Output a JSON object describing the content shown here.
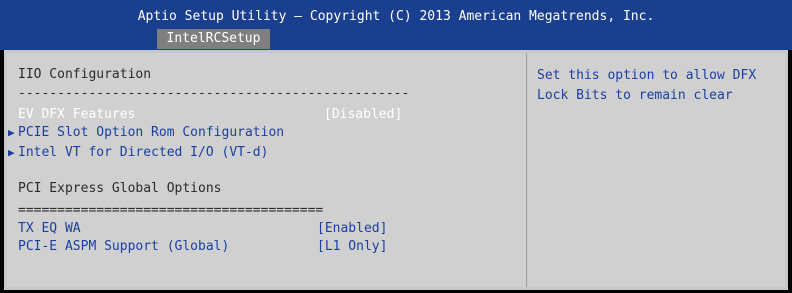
{
  "header": {
    "title": "Aptio Setup Utility – Copyright (C) 2013 American Megatrends, Inc.",
    "active_tab": "IntelRCSetup"
  },
  "main": {
    "section_title": "IIO Configuration",
    "separator_dash": "--------------------------------------------------",
    "items": [
      {
        "label": "EV DFX Features",
        "value": "[Disabled]"
      },
      {
        "label": "PCIE Slot Option Rom Configuration"
      },
      {
        "label": "Intel VT for Directed I/O (VT-d)"
      }
    ],
    "subsection_title": "PCI Express Global Options",
    "separator_eq": "=======================================",
    "global_items": [
      {
        "label": "TX EQ WA",
        "value": "[Enabled]"
      },
      {
        "label": "PCI-E ASPM Support (Global)",
        "value": "[L1 Only]"
      }
    ],
    "submenu_arrow": "▶"
  },
  "help": {
    "lines": [
      "Set this option to allow DFX",
      "Lock Bits to remain clear"
    ]
  },
  "colors": {
    "header_bg": "#1a3f8e",
    "panel_bg": "#d0d0d0",
    "selected_text": "#ffffff",
    "item_text": "#1a3fa0"
  }
}
